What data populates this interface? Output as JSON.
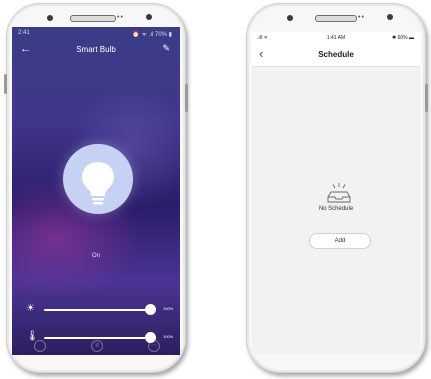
{
  "left_phone": {
    "status_time": "2:41",
    "status_right": "⏰ ᯤ .ıl 70% ▮",
    "title": "Smart Bulb",
    "back_icon": "arrow-left-icon",
    "edit_icon": "pencil-icon",
    "bulb_icon": "light-bulb-icon",
    "state_label": "On",
    "brightness": {
      "icon": "sun-icon",
      "value_label": "100%",
      "value": 100
    },
    "temperature": {
      "icon": "thermometer-icon",
      "value_label": "100%",
      "value": 100
    },
    "nav_icons": [
      "circle-icon",
      "menu-icon",
      "more-icon"
    ]
  },
  "right_phone": {
    "status_left": ".ıll ᯤ",
    "status_time": "1:41 AM",
    "status_right": "✱ 60% ▬",
    "title": "Schedule",
    "back_icon": "chevron-left-icon",
    "empty_icon": "empty-tray-icon",
    "empty_text": "No Schedule",
    "add_label": "Add"
  },
  "colors": {
    "bulb_circle": "#c7d1f3",
    "left_bg_top": "#3a3d86",
    "left_bg_bottom": "#2b1e5e",
    "right_bg": "#f2f2f2"
  }
}
